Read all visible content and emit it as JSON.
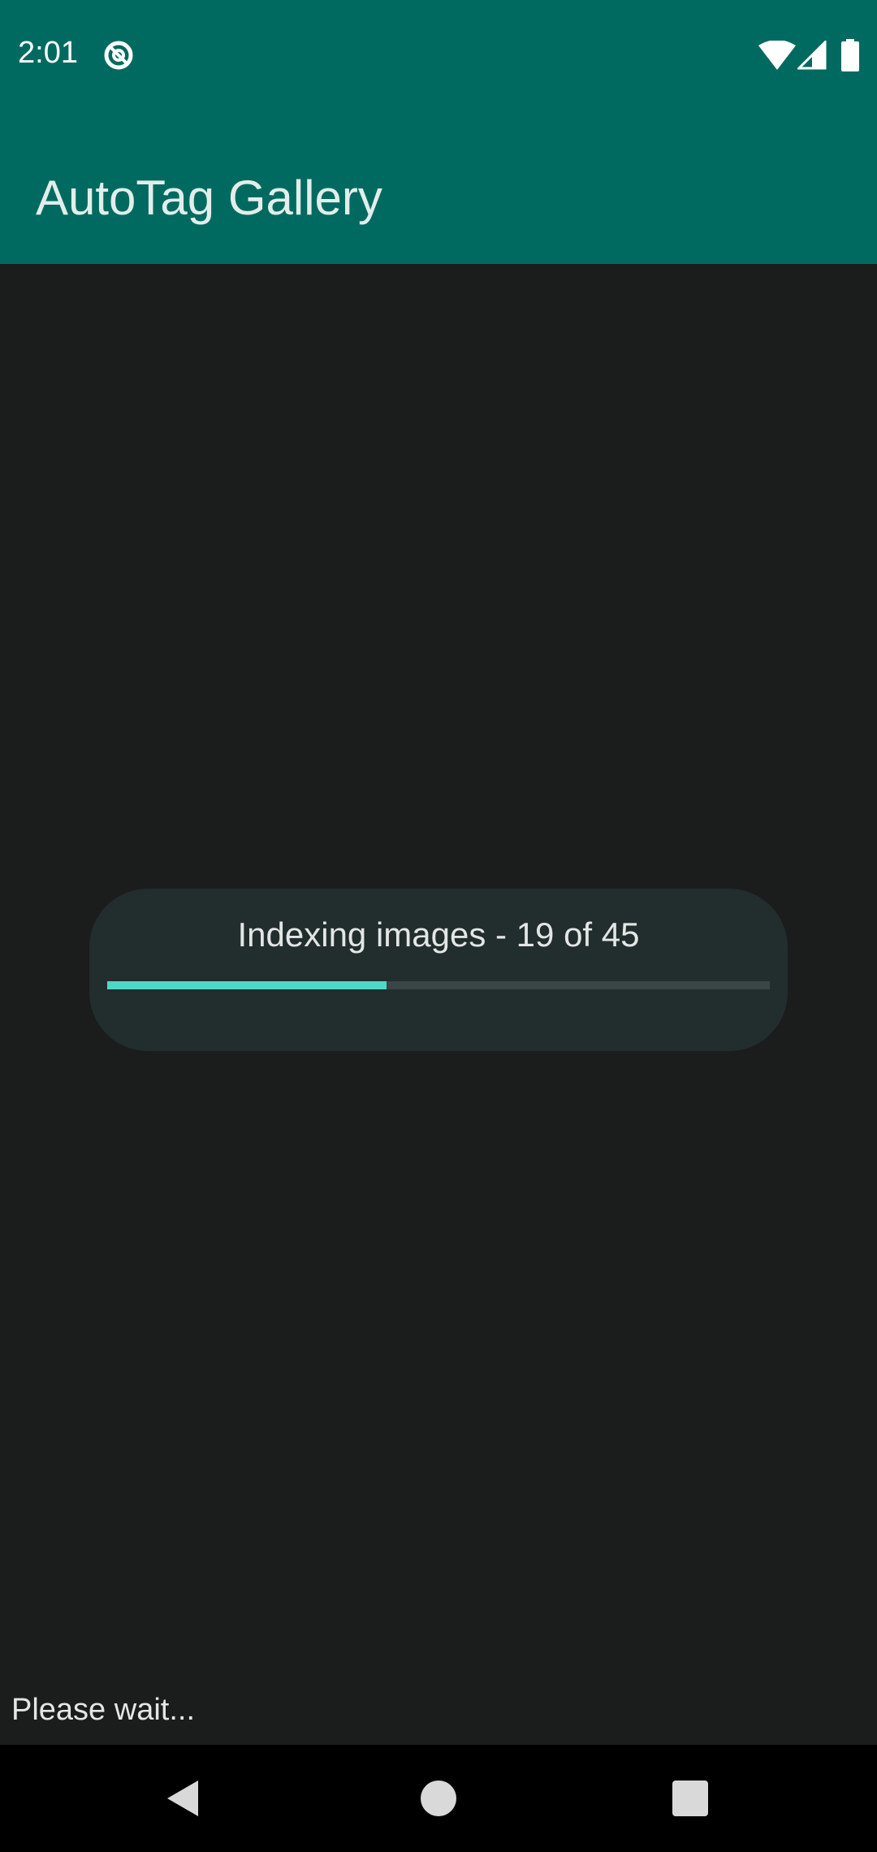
{
  "status_bar": {
    "time": "2:01",
    "app_icon": "at-sign-icon",
    "wifi_icon": "wifi-icon",
    "signal_icon": "cellular-signal-icon",
    "battery_icon": "battery-icon",
    "background_color": "#016a60"
  },
  "app_bar": {
    "title": "AutoTag Gallery",
    "background_color": "#016a60"
  },
  "progress_dialog": {
    "text": "Indexing images - 19 of 45",
    "current": 19,
    "total": 45,
    "progress_fraction": 0.422,
    "accent_color": "#4fd8c5"
  },
  "footer": {
    "status_text": "Please wait..."
  },
  "nav_bar": {
    "back_icon": "back-triangle-icon",
    "home_icon": "home-circle-icon",
    "recents_icon": "recents-square-icon"
  }
}
